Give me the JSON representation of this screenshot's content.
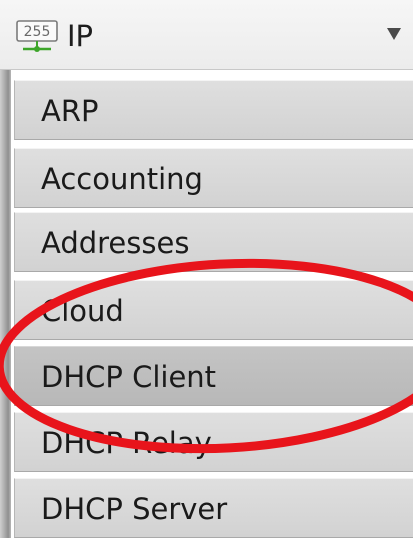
{
  "header": {
    "icon": "ip-network-icon",
    "icon_text": "255",
    "title": "IP",
    "arrow": "dropdown-arrow-icon"
  },
  "submenu": {
    "items": [
      {
        "label": "ARP"
      },
      {
        "label": "Accounting"
      },
      {
        "label": "Addresses"
      },
      {
        "label": "Cloud"
      },
      {
        "label": "DHCP Client",
        "active": true
      },
      {
        "label": "DHCP Relay"
      },
      {
        "label": "DHCP Server"
      }
    ]
  },
  "annotation": {
    "shape": "ellipse",
    "color": "#e8141b"
  },
  "colors": {
    "header_bg": "#ececec",
    "item_bg": "#d6d6d6",
    "item_active_bg": "#bdbdbd",
    "text": "#1a1a1a"
  }
}
